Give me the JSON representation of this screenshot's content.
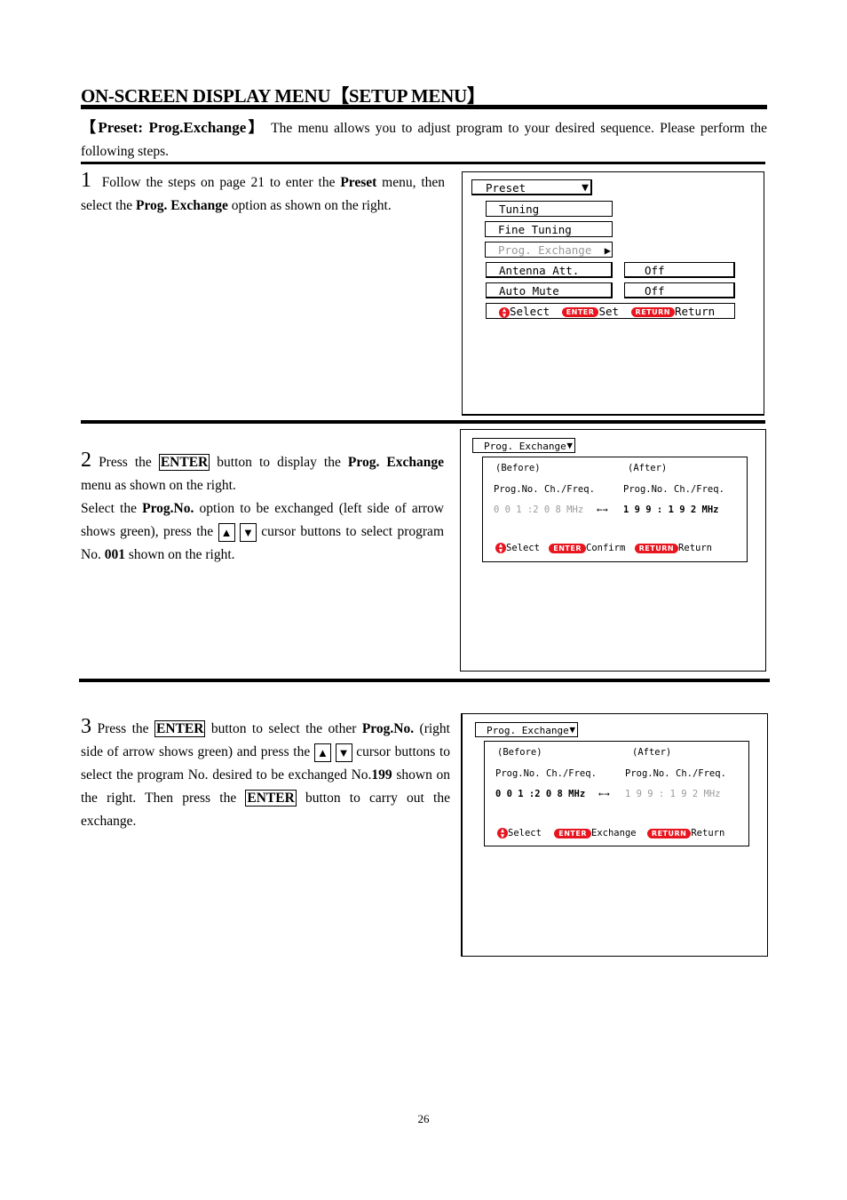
{
  "page": {
    "title": "ON-SCREEN DISPLAY MENU【SETUP MENU】",
    "intro": {
      "bold": "【Preset: Prog.Exchange】",
      "text": " The menu allows you to adjust program to your desired sequence. Please perform the following steps."
    },
    "page_number": "26"
  },
  "steps": [
    {
      "number": "1",
      "parts": [
        "Follow the steps on page 21 to enter the ",
        "Preset",
        " menu, then select the ",
        "Prog. Exchange",
        " option as shown on the right."
      ]
    },
    {
      "number": "2",
      "parts": [
        "Press the ",
        "ENTER",
        " button to display the ",
        "Prog. Exchange",
        " menu as shown on the right.",
        "Select the ",
        "Prog.No.",
        " option to be exchanged (left side of arrow shows green), press the ",
        "▲",
        "▼",
        " cursor buttons to select program No. ",
        "001",
        " shown on the right."
      ]
    },
    {
      "number": "3",
      "parts": [
        "Press the ",
        "ENTER",
        " button to select the other ",
        "Prog.No.",
        " (right side of arrow shows green) and press the ",
        "▲",
        "▼",
        " cursor buttons to select the program No. desired to be exchanged No.",
        "199",
        " shown on the right. Then press the ",
        "ENTER",
        " button to carry out the exchange."
      ]
    }
  ],
  "osd1": {
    "header": "Preset",
    "header_icon": "triangle-down",
    "items": [
      {
        "label": "Tuning"
      },
      {
        "label": "Fine Tuning"
      },
      {
        "label": "Prog. Exchange",
        "selected": true,
        "icon": "triangle-right"
      },
      {
        "label": "Antenna Att.",
        "value": "Off"
      },
      {
        "label": "Auto Mute",
        "value": "Off"
      }
    ],
    "footer": {
      "select": "Select",
      "enter_pill": "ENTER",
      "enter_label": "Set",
      "return_pill": "RETURN",
      "return_label": "Return"
    }
  },
  "osd2": {
    "header": "Prog. Exchange",
    "before_label": "(Before)",
    "after_label": "(After)",
    "col_headers": [
      "Prog.No.",
      "Ch./Freq.",
      "Prog.No.",
      "Ch./Freq."
    ],
    "before_value": "0 0 1 :2 0 8 MHz",
    "arrow": "←→",
    "after_value": "1 9 9 : 1 9 2 MHz",
    "footer": {
      "select": "Select",
      "enter_pill": "ENTER",
      "enter_label": "Confirm",
      "return_pill": "RETURN",
      "return_label": "Return"
    }
  },
  "osd3": {
    "header": "Prog. Exchange",
    "before_label": "(Before)",
    "after_label": "(After)",
    "col_headers": [
      "Prog.No.",
      "Ch./Freq.",
      "Prog.No.",
      "Ch./Freq."
    ],
    "before_value": "0 0 1 :2 0 8 MHz",
    "arrow": "←→",
    "after_value": "1 9 9 : 1 9 2 MHz",
    "footer": {
      "select": "Select",
      "enter_pill": "ENTER",
      "enter_label": "Exchange",
      "return_pill": "RETURN",
      "return_label": "Return"
    }
  },
  "colors": {
    "accent_red": "#e8141e",
    "dim_text": "#9a9a9a"
  }
}
